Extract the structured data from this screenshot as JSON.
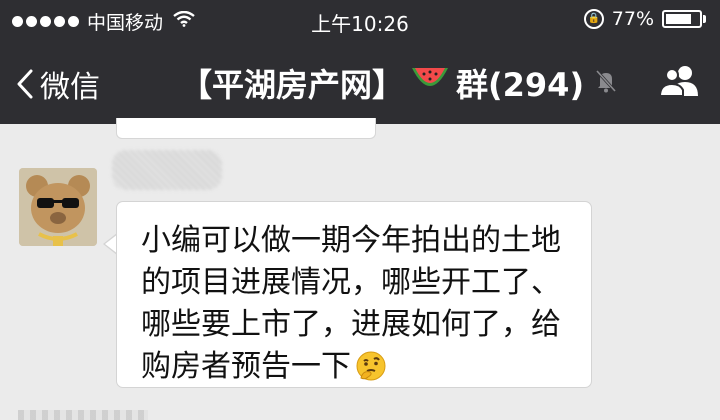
{
  "status_bar": {
    "carrier": "中国移动",
    "time": "上午10:26",
    "battery_percent": "77%",
    "battery_level": 0.77,
    "icons": [
      "signal-dots-icon",
      "wifi-icon",
      "rotation-lock-icon",
      "battery-icon"
    ]
  },
  "nav": {
    "back_label": "微信",
    "title_left": "【平湖房产网】",
    "title_right": "群(294)",
    "icons": [
      "chevron-left-icon",
      "watermelon-icon",
      "mute-bell-icon",
      "group-members-icon"
    ]
  },
  "message": {
    "lines": [
      "小编可以做一期今年拍出的土地",
      "的项目进展情况，哪些开工了、",
      "哪些要上市了，进展如何了，给",
      "购房者预告一下"
    ],
    "emoji": "thinking-face-icon"
  },
  "colors": {
    "header_bg": "#2e2e32",
    "chat_bg": "#ebebeb",
    "bubble_bg": "#ffffff"
  }
}
